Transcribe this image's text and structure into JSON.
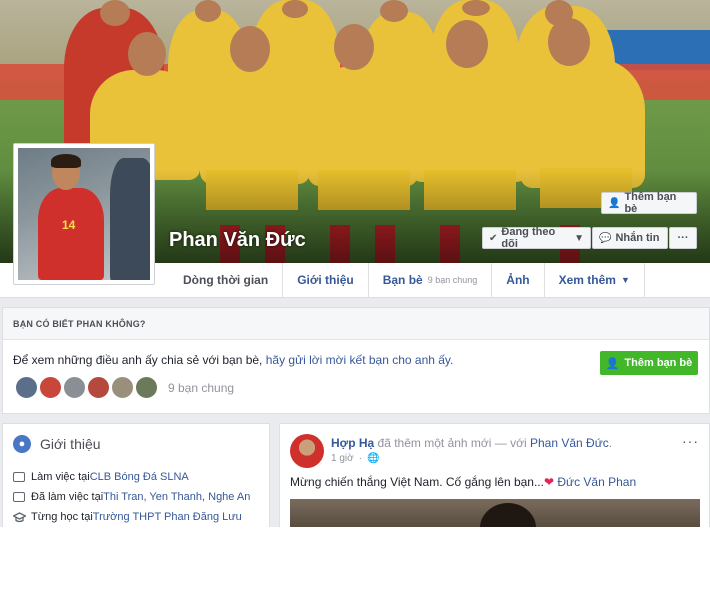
{
  "profile": {
    "name": "Phan Văn Đức",
    "jersey_number": "14"
  },
  "cover_actions": {
    "add_friend": "Thêm bạn bè",
    "following": "Đang theo dõi",
    "message": "Nhắn tin",
    "more": "···"
  },
  "tabs": [
    {
      "label": "Dòng thời gian",
      "active": true
    },
    {
      "label": "Giới thiệu"
    },
    {
      "label": "Bạn bè",
      "sub": "9 bạn chung"
    },
    {
      "label": "Ảnh"
    },
    {
      "label": "Xem thêm"
    }
  ],
  "know": {
    "heading": "BẠN CÓ BIẾT PHAN KHÔNG?",
    "text": "Để xem những điều anh ấy chia sẻ với bạn bè, ",
    "link": "hãy gửi lời mời kết bạn cho anh ấy.",
    "add_button": "Thêm bạn bè",
    "mutual": "9 bạn chung",
    "friend_colors": [
      "#5c6f8a",
      "#c8463a",
      "#8a8f95",
      "#b5493d",
      "#9a8f7a",
      "#6b7a5a"
    ]
  },
  "intro": {
    "title": "Giới thiệu",
    "rows": [
      {
        "text": "Làm việc tại ",
        "link": "CLB Bóng Đá SLNA"
      },
      {
        "text": "Đã làm việc tại ",
        "link": "Thi Tran, Yen Thanh, Nghe An"
      },
      {
        "text": "Từng học tại ",
        "link": "Trường THPT Phan Đăng Lưu"
      }
    ]
  },
  "post": {
    "author": "Hợp Hạ",
    "action": " đã thêm một ảnh mới — với ",
    "with": "Phan Văn Đức",
    "end": ".",
    "time": "1 giờ",
    "dots": "···",
    "text": "Mừng chiến thắng Việt Nam. Cố gắng lên bạn...",
    "heart": "❤",
    "tag": "Đức Văn Phan"
  }
}
